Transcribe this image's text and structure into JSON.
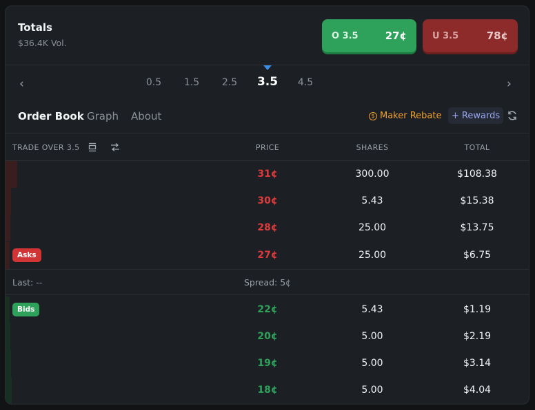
{
  "market": {
    "title": "Totals",
    "volume": "$36.4K Vol."
  },
  "outcomes": [
    {
      "label": "O 3.5",
      "price": "27¢",
      "color": "#2ea25a"
    },
    {
      "label": "U 3.5",
      "price": "78¢",
      "color": "#8d2a2a"
    }
  ],
  "lines": [
    "0.5",
    "1.5",
    "2.5",
    "3.5",
    "4.5"
  ],
  "selected_line": "3.5",
  "tabs": [
    "Order Book",
    "Graph",
    "About"
  ],
  "active_tab": "Order Book",
  "maker_rebate": "Maker Rebate",
  "rewards": "Rewards",
  "columns": {
    "trade": "TRADE OVER 3.5",
    "price": "PRICE",
    "shares": "SHARES",
    "total": "TOTAL"
  },
  "asks": [
    {
      "price": "31¢",
      "shares": "300.00",
      "total": "$108.38"
    },
    {
      "price": "30¢",
      "shares": "5.43",
      "total": "$15.38"
    },
    {
      "price": "28¢",
      "shares": "25.00",
      "total": "$13.75"
    },
    {
      "price": "27¢",
      "shares": "25.00",
      "total": "$6.75"
    }
  ],
  "asks_badge": "Asks",
  "last": "Last: --",
  "spread": "Spread: 5¢",
  "bids": [
    {
      "price": "22¢",
      "shares": "5.43",
      "total": "$1.19"
    },
    {
      "price": "20¢",
      "shares": "5.00",
      "total": "$2.19"
    },
    {
      "price": "19¢",
      "shares": "5.00",
      "total": "$3.14"
    },
    {
      "price": "18¢",
      "shares": "5.00",
      "total": "$4.04"
    }
  ],
  "bids_badge": "Bids",
  "colors": {
    "ask": "#dd3b3b",
    "bid": "#2ea25a",
    "accent": "#3b8ee8",
    "rebate": "#f0a22e"
  }
}
